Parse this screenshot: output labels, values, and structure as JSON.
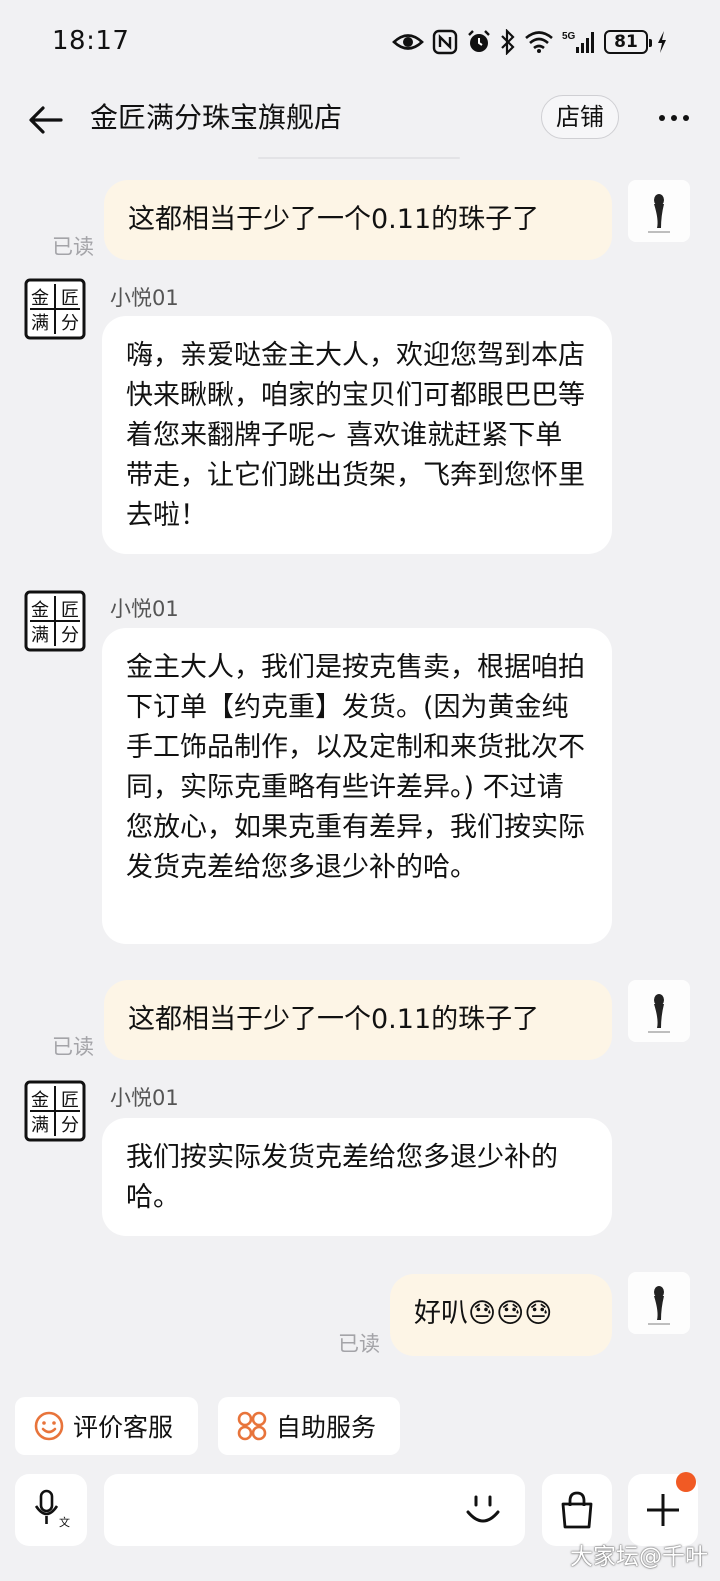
{
  "status_bar": {
    "time": "18:17",
    "battery": "81"
  },
  "header": {
    "title": "金匠满分珠宝旗舰店",
    "shop_button": "店铺"
  },
  "messages": [
    {
      "from": "me",
      "text": "这都相当于少了一个0.11的珠子了",
      "status": "已读"
    },
    {
      "from": "shop",
      "sender": "小悦01",
      "text": "嗨，亲爱哒金主大人，欢迎您驾到本店 快来瞅瞅，咱家的宝贝们可都眼巴巴等着您来翻牌子呢~ 喜欢谁就赶紧下单带走，让它们跳出货架，飞奔到您怀里去啦！"
    },
    {
      "from": "shop",
      "sender": "小悦01",
      "text": "金主大人，我们是按克售卖，根据咱拍下订单【约克重】发货。(因为黄金纯手工饰品制作，以及定制和来货批次不同，实际克重略有些许差异。) 不过请您放心，如果克重有差异，我们按实际发货克差给您多退少补的哈。"
    },
    {
      "from": "me",
      "text": "这都相当于少了一个0.11的珠子了",
      "status": "已读"
    },
    {
      "from": "shop",
      "sender": "小悦01",
      "text": "我们按实际发货克差给您多退少补的哈。"
    },
    {
      "from": "me",
      "text": "好叭😓😓😓",
      "status": "已读"
    }
  ],
  "shop_avatar_chars": [
    "金",
    "匠",
    "满",
    "分"
  ],
  "quick_actions": {
    "rate": "评价客服",
    "self_service": "自助服务"
  },
  "watermark": "大家坛@千叶",
  "colors": {
    "my_bubble": "#fdf5e6",
    "their_bubble": "#ffffff",
    "background": "#f1f1f3",
    "icon_orange": "#e8743b",
    "badge": "#f15a24"
  }
}
